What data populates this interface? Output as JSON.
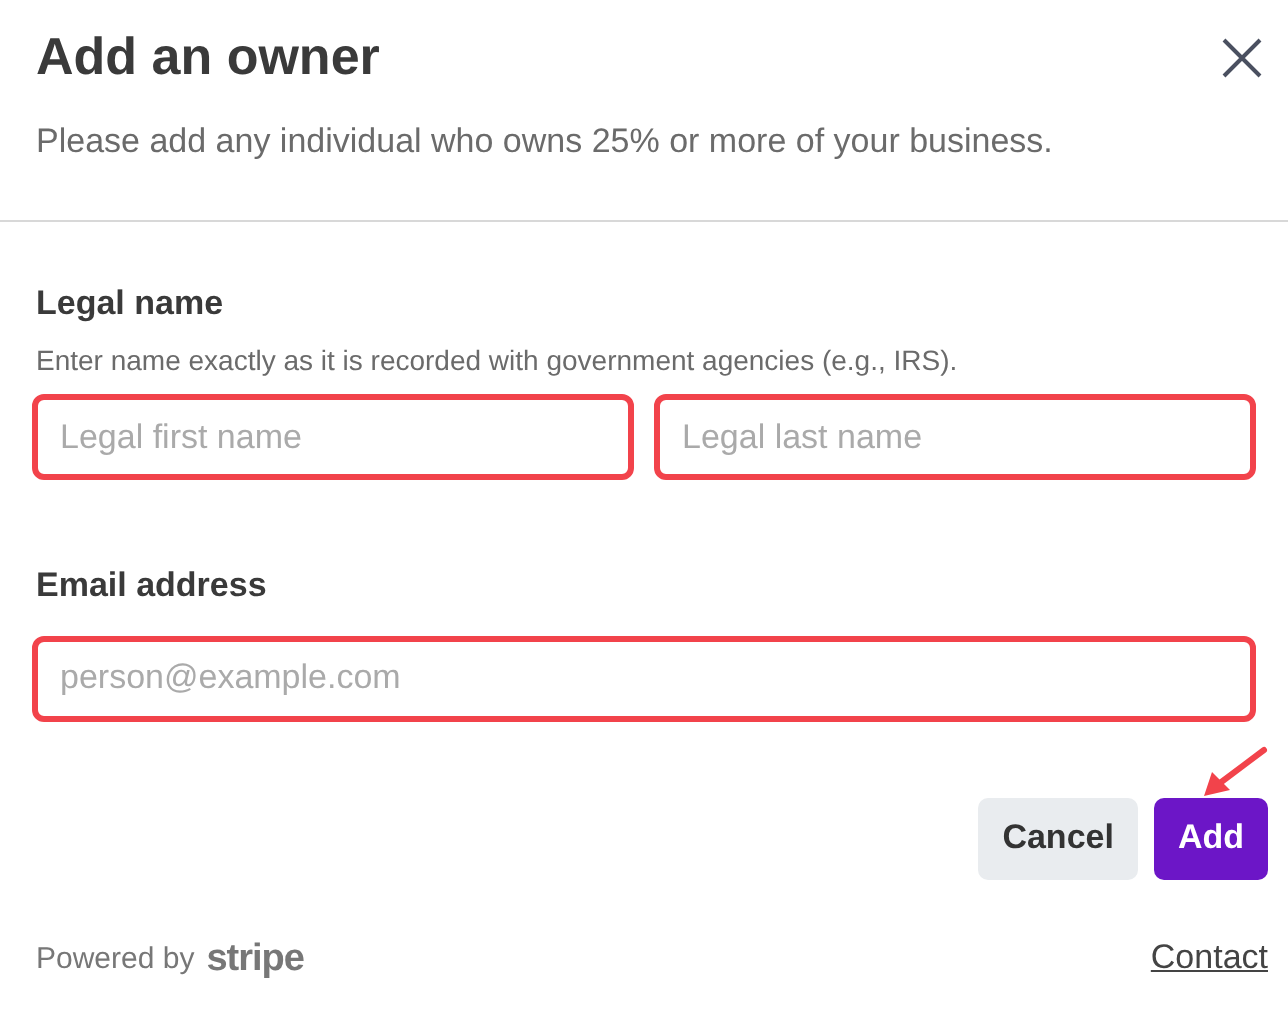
{
  "dialog": {
    "title": "Add an owner",
    "subtitle": "Please add any individual who owns 25% or more of your business."
  },
  "sections": [
    {
      "label": "Legal name",
      "hint": "Enter name exactly as it is recorded with government agencies (e.g., IRS).",
      "fields": [
        {
          "placeholder": "Legal first name",
          "highlighted": true
        },
        {
          "placeholder": "Legal last name",
          "highlighted": true
        }
      ]
    },
    {
      "label": "Email address",
      "fields": [
        {
          "placeholder": "person@example.com",
          "highlighted": true
        }
      ]
    }
  ],
  "buttons": [
    {
      "label": "Cancel",
      "kind": "secondary",
      "annotated": false
    },
    {
      "label": "Add",
      "kind": "primary",
      "annotated": true
    }
  ],
  "footer": {
    "powered_by": "Powered by",
    "brand": "stripe",
    "link": "Contact"
  }
}
